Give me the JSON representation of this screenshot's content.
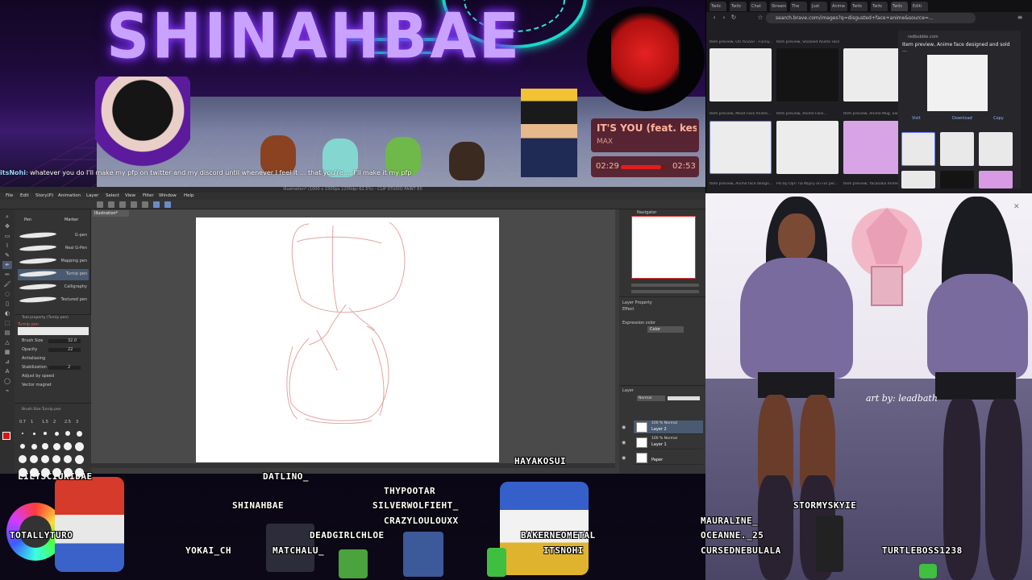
{
  "banner": {
    "title": "SHINAHBAE",
    "now_playing": {
      "title": "IT'S YOU (feat. keshi)",
      "artist": "MAX",
      "elapsed": "02:29",
      "total": "02:53",
      "progress": 0.86
    }
  },
  "chat": {
    "user": "itsNohi",
    "message": ": whatever you do I'll make my pfp on twitter and my discord until whenever I feel it ... that you're ... I'll make it my pfp"
  },
  "browser": {
    "url": "search.brave.com/images?q=disgusted+face+anime&source=...",
    "tabs": [
      "Twitc",
      "Twitc",
      "Chat",
      "Stream",
      "The",
      "Just",
      "Anime",
      "Twitc",
      "Twitc",
      "Twitc",
      "Editi"
    ],
    "results": [
      {
        "caption": "Item preview, OU YESSS! - Funny..."
      },
      {
        "caption": "Item preview, Shocked Anime Face..."
      },
      {
        "caption": "Item preview, Anime Mug, Sar..."
      },
      {
        "caption": "Item preview, Mood Face Anime..."
      },
      {
        "caption": "Item preview, Anime Face..."
      },
      {
        "caption": "Item preview, Anime face design..."
      },
      {
        "caption": "Pin by Opri Tia Myyry on For per..."
      },
      {
        "caption": "Item preview, Yacanalia Anime..."
      }
    ],
    "side_panel": {
      "source": "redbubble.com",
      "title": "Item preview, Anime face designed and sold ...",
      "actions": [
        "Visit",
        "Download",
        "Copy"
      ]
    }
  },
  "csp": {
    "window_title": "Illustration* (1000 x 1500px 1200dpi 62.5%) - CLIP STUDIO PAINT EX",
    "menus": [
      "File",
      "Edit",
      "Story(P)",
      "Animation",
      "Layer",
      "Select",
      "View",
      "Filter",
      "Window",
      "Help"
    ],
    "subtool_tabs": [
      "Pen",
      "Marker"
    ],
    "brushes": [
      "G-pen",
      "Real G-Pen",
      "Mapping pen",
      "Turnip pen",
      "Calligraphy",
      "Textured pen"
    ],
    "tool_property": {
      "title": "Tool property (Turnip pen)",
      "brush_name": "Turnip pen",
      "rows": [
        {
          "label": "Brush Size",
          "value": "32.0"
        },
        {
          "label": "Opacity",
          "value": "22"
        },
        {
          "label": "Antialiasing",
          "value": ""
        },
        {
          "label": "Stabilization",
          "value": "2"
        },
        {
          "label": "Adjust by speed",
          "value": ""
        },
        {
          "label": "Vector magnet",
          "value": ""
        }
      ]
    },
    "brush_size_title": "Brush Size Turnip pen",
    "brush_sizes": [
      "0.7",
      "1",
      "1.5",
      "2",
      "2.5",
      "3"
    ],
    "canvas_tab": "Illustration*",
    "navigator_label": "Navigator",
    "layer_property_label": "Layer Property",
    "effect_label": "Effect",
    "expression_label": "Expression color",
    "expression_value": "Color",
    "layers_label": "Layer",
    "blend_mode": "Normal",
    "layers": [
      {
        "mode": "100 % Normal",
        "name": "Layer 2",
        "selected": true
      },
      {
        "mode": "100 % Normal",
        "name": "Layer 1",
        "selected": false
      },
      {
        "mode": "",
        "name": "Paper",
        "selected": false
      }
    ]
  },
  "art": {
    "credit": "art by: leadbath"
  },
  "usernames": [
    "HAYAKOSUI",
    "LILYSCIURIDAE",
    "DATLINO_",
    "THYPOOTAR",
    "SHINAHBAE",
    "SILVERWOLFIEHT_",
    "CRAZYLOULOUXX",
    "TOTALLYTURO",
    "DEADGIRLCHLOE",
    "BAKERNEOMETAL",
    "YOKAI_CH",
    "MATCHALU_",
    "ITSNOHI",
    "MAURALINE_",
    "STORMYSKYIE",
    "OCEANNE._25",
    "CURSEDNEBULALA",
    "TURTLEBOSS1238"
  ],
  "colors": {
    "accent_neon": "#16d9c9",
    "title_purple": "#c9a2ff",
    "brush_red": "#d61616",
    "hoodie": "#7a6b9e"
  }
}
